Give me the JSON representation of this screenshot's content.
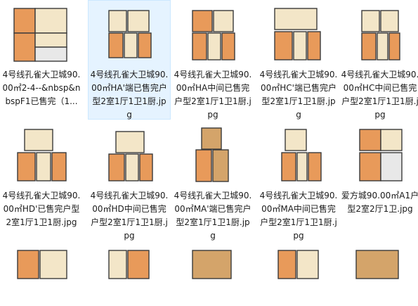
{
  "files": [
    {
      "name": "4号线孔雀大卫城90.00㎡2-4--&nbsp&nbspF1已售完（1...",
      "selected": false,
      "plan": "A"
    },
    {
      "name": "4号线孔雀大卫城90.00㎡HA'端已售完户型2室1厅1卫1厨.jpg",
      "selected": true,
      "plan": "B"
    },
    {
      "name": "4号线孔雀大卫城90.00㎡HA中间已售完户型2室1厅1卫1厨.jpg",
      "selected": false,
      "plan": "C"
    },
    {
      "name": "4号线孔雀大卫城90.00㎡HC'端已售完户型2室1厅1卫1厨.jpg",
      "selected": false,
      "plan": "D"
    },
    {
      "name": "4号线孔雀大卫城90.00㎡HC中间已售完户型2室1厅1卫1厨.jpg",
      "selected": false,
      "plan": "E"
    },
    {
      "name": "4号线孔雀大卫城90.00㎡HD'已售完户型2室1厅1卫1厨.jpg",
      "selected": false,
      "plan": "F"
    },
    {
      "name": "4号线孔雀大卫城90.00㎡HD中间已售完户型2室1厅1卫1厨.jpg",
      "selected": false,
      "plan": "G"
    },
    {
      "name": "4号线孔雀大卫城90.00㎡MA'端已售完户型2室1厅1卫1厨.jpg",
      "selected": false,
      "plan": "H"
    },
    {
      "name": "4号线孔雀大卫城90.00㎡MA中间已售完户型2室1厅1卫1厨.jpg",
      "selected": false,
      "plan": "I"
    },
    {
      "name": "爱方城90.00㎡A1户型2室2厅1卫.jpg",
      "selected": false,
      "plan": "J"
    },
    {
      "name": "",
      "selected": false,
      "plan": "K"
    },
    {
      "name": "",
      "selected": false,
      "plan": "L"
    },
    {
      "name": "",
      "selected": false,
      "plan": "M"
    },
    {
      "name": "",
      "selected": false,
      "plan": "N"
    },
    {
      "name": "",
      "selected": false,
      "plan": "O"
    }
  ],
  "colors": {
    "wall": "#3a3a3a",
    "orange_room": "#e89a5a",
    "cream_room": "#f3e6c8",
    "wood_floor": "#d4a46a",
    "tile_floor": "#e8e8e8",
    "selected_bg": "#e5f3ff"
  }
}
